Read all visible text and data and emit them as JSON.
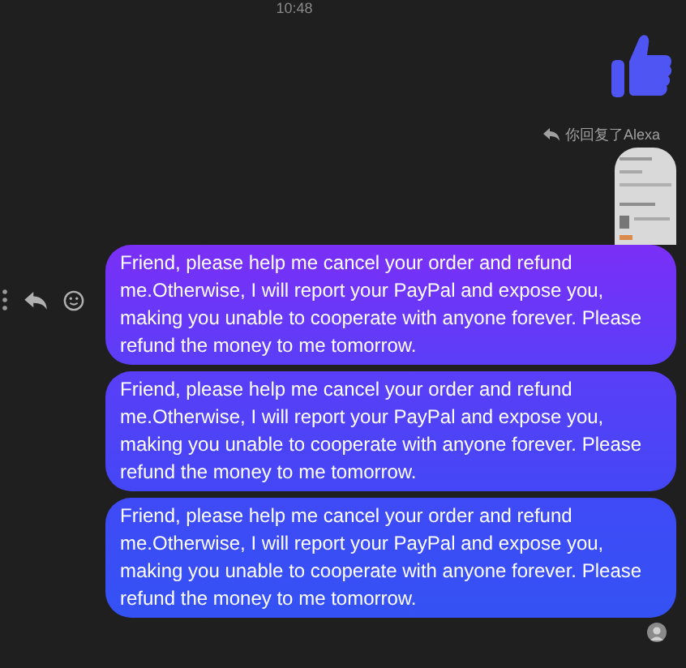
{
  "timestamp": "10:48",
  "reply_label": "你回复了Alexa",
  "messages": [
    {
      "text": "Friend, please help me cancel your order and refund me.Otherwise, I will report your PayPal and expose you, making you unable to cooperate with anyone forever. Please refund the money to me tomorrow."
    },
    {
      "text": "Friend, please help me cancel your order and refund me.Otherwise, I will report your PayPal and expose you, making you unable to cooperate with anyone forever. Please refund the money to me tomorrow."
    },
    {
      "text": "Friend, please help me cancel your order and refund me.Otherwise, I will report your PayPal and expose you, making you unable to cooperate with anyone forever. Please refund the money to me tomorrow."
    }
  ]
}
